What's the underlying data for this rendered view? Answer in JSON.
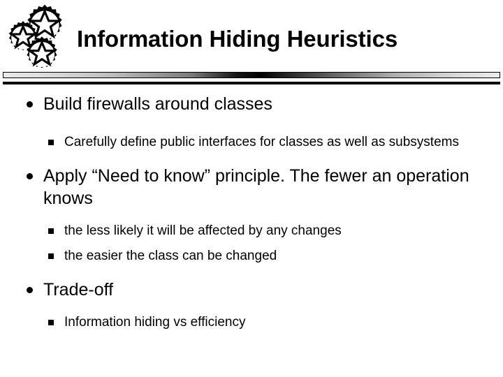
{
  "slide": {
    "title": "Information Hiding Heuristics",
    "logo_icon": "interlocking-gears-icon",
    "colors": {
      "text": "#000000",
      "background": "#ffffff",
      "divider_light": "#ededed",
      "divider_dark": "#000000"
    },
    "bullets": [
      {
        "level": 1,
        "marker": "disc-bullet-icon",
        "text": "Build firewalls around classes"
      },
      {
        "level": 2,
        "marker": "square-bullet-icon",
        "text": "Carefully define public interfaces for classes as well as subsystems"
      },
      {
        "level": 1,
        "marker": "disc-bullet-icon",
        "text": "Apply “Need to know” principle. The fewer an operation knows"
      },
      {
        "level": 2,
        "marker": "square-bullet-icon",
        "text": "the less likely it will be affected by any changes"
      },
      {
        "level": 2,
        "marker": "square-bullet-icon",
        "text": "the easier the class can be changed"
      },
      {
        "level": 1,
        "marker": "disc-bullet-icon",
        "text": "Trade-off"
      },
      {
        "level": 2,
        "marker": "square-bullet-icon",
        "text": "Information hiding vs efficiency"
      }
    ]
  }
}
